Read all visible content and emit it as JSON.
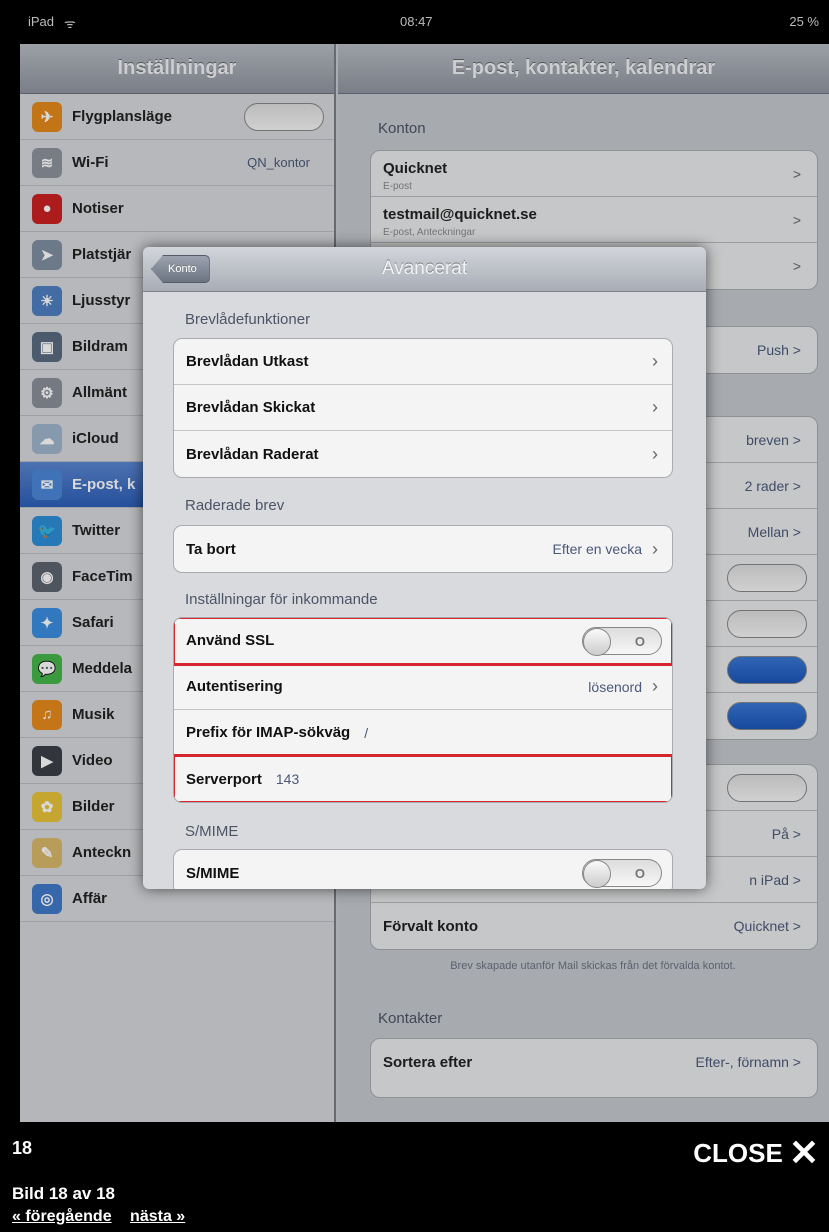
{
  "status": {
    "device": "iPad",
    "wifi": "ᯤ",
    "time": "08:47",
    "battery": "25 %"
  },
  "left": {
    "title": "Inställningar",
    "items": [
      {
        "label": "Flygplansläge",
        "value": "",
        "toggle": true,
        "icon": "airplane-icon",
        "color": "#e38a1b",
        "glyph": "✈"
      },
      {
        "label": "Wi-Fi",
        "value": "QN_kontor",
        "toggle": false,
        "icon": "wifi-icon",
        "color": "#8d939d",
        "glyph": "≋"
      },
      {
        "label": "Notiser",
        "value": "",
        "toggle": false,
        "icon": "notification-icon",
        "color": "#cc2222",
        "glyph": "●"
      },
      {
        "label": "Platstjär",
        "value": "",
        "toggle": false,
        "icon": "location-icon",
        "color": "#7f8fa0",
        "glyph": "➤"
      },
      {
        "label": "Ljusstyr",
        "value": "",
        "toggle": false,
        "icon": "brightness-icon",
        "color": "#4f7fc2",
        "glyph": "☀"
      },
      {
        "label": "Bildram",
        "value": "",
        "toggle": false,
        "icon": "picture-frame-icon",
        "color": "#596a81",
        "glyph": "▣"
      },
      {
        "label": "Allmänt",
        "value": "",
        "toggle": false,
        "icon": "general-gear-icon",
        "color": "#8a8f99",
        "glyph": "⚙"
      },
      {
        "label": "iCloud",
        "value": "",
        "toggle": false,
        "icon": "icloud-icon",
        "color": "#9fb4cc",
        "glyph": "☁"
      },
      {
        "label": "E-post, k",
        "value": "",
        "toggle": false,
        "icon": "mail-icon",
        "color": "#4a86d8",
        "glyph": "✉",
        "selected": true
      },
      {
        "label": "Twitter",
        "value": "",
        "toggle": false,
        "icon": "twitter-icon",
        "color": "#2d8ed8",
        "glyph": "🐦"
      },
      {
        "label": "FaceTim",
        "value": "",
        "toggle": false,
        "icon": "facetime-icon",
        "color": "#5d6470",
        "glyph": "◉"
      },
      {
        "label": "Safari",
        "value": "",
        "toggle": false,
        "icon": "safari-icon",
        "color": "#3a8ee0",
        "glyph": "✦"
      },
      {
        "label": "Meddela",
        "value": "",
        "toggle": false,
        "icon": "messages-icon",
        "color": "#47b649",
        "glyph": "💬"
      },
      {
        "label": "Musik",
        "value": "",
        "toggle": false,
        "icon": "music-icon",
        "color": "#e58a1c",
        "glyph": "♫"
      },
      {
        "label": "Video",
        "value": "",
        "toggle": false,
        "icon": "video-icon",
        "color": "#3b3f47",
        "glyph": "▶"
      },
      {
        "label": "Bilder",
        "value": "",
        "toggle": false,
        "icon": "photos-icon",
        "color": "#e8c43a",
        "glyph": "✿"
      },
      {
        "label": "Anteckn",
        "value": "",
        "toggle": false,
        "icon": "notes-icon",
        "color": "#d9b96a",
        "glyph": "✎"
      },
      {
        "label": "Affär",
        "value": "",
        "toggle": false,
        "icon": "store-icon",
        "color": "#4179c9",
        "glyph": "◎"
      }
    ]
  },
  "right": {
    "title": "E-post, kontakter, kalendrar",
    "accounts_header": "Konton",
    "accounts": [
      {
        "name": "Quicknet",
        "sub": "E-post"
      },
      {
        "name": "testmail@quicknet.se",
        "sub": "E-post, Anteckningar"
      }
    ],
    "push_value": "Push",
    "values": [
      "breven",
      "2 rader",
      "Mellan"
    ],
    "pa_value": "På",
    "ipad_value": "n iPad",
    "default_account_label": "Förvalt konto",
    "default_account_value": "Quicknet",
    "default_note": "Brev skapade utanför Mail skickas från det förvalda kontot.",
    "contacts_header": "Kontakter",
    "sort_label": "Sortera efter",
    "sort_value": "Efter-, förnamn"
  },
  "modal": {
    "back_label": "Konto",
    "title": "Avancerat",
    "section1": "Brevlådefunktioner",
    "mailbox_rows": [
      "Brevlådan Utkast",
      "Brevlådan Skickat",
      "Brevlådan Raderat"
    ],
    "section2": "Raderade brev",
    "remove_label": "Ta bort",
    "remove_value": "Efter en vecka",
    "section3": "Inställningar för inkommande",
    "ssl_label": "Använd SSL",
    "ssl_state": "O",
    "auth_label": "Autentisering",
    "auth_value": "lösenord",
    "prefix_label": "Prefix för IMAP-sökväg",
    "prefix_value": "/",
    "port_label": "Serverport",
    "port_value": "143",
    "section4": "S/MIME",
    "smime_label": "S/MIME",
    "smime_state": "O"
  },
  "footer": {
    "number": "18",
    "close_label": "CLOSE",
    "close_icon": "✕",
    "caption": "Bild 18 av 18",
    "prev": "« föregående",
    "next": "nästa »"
  },
  "colors": {
    "highlight": "#d4262c",
    "selected": "#2c5fb8"
  }
}
